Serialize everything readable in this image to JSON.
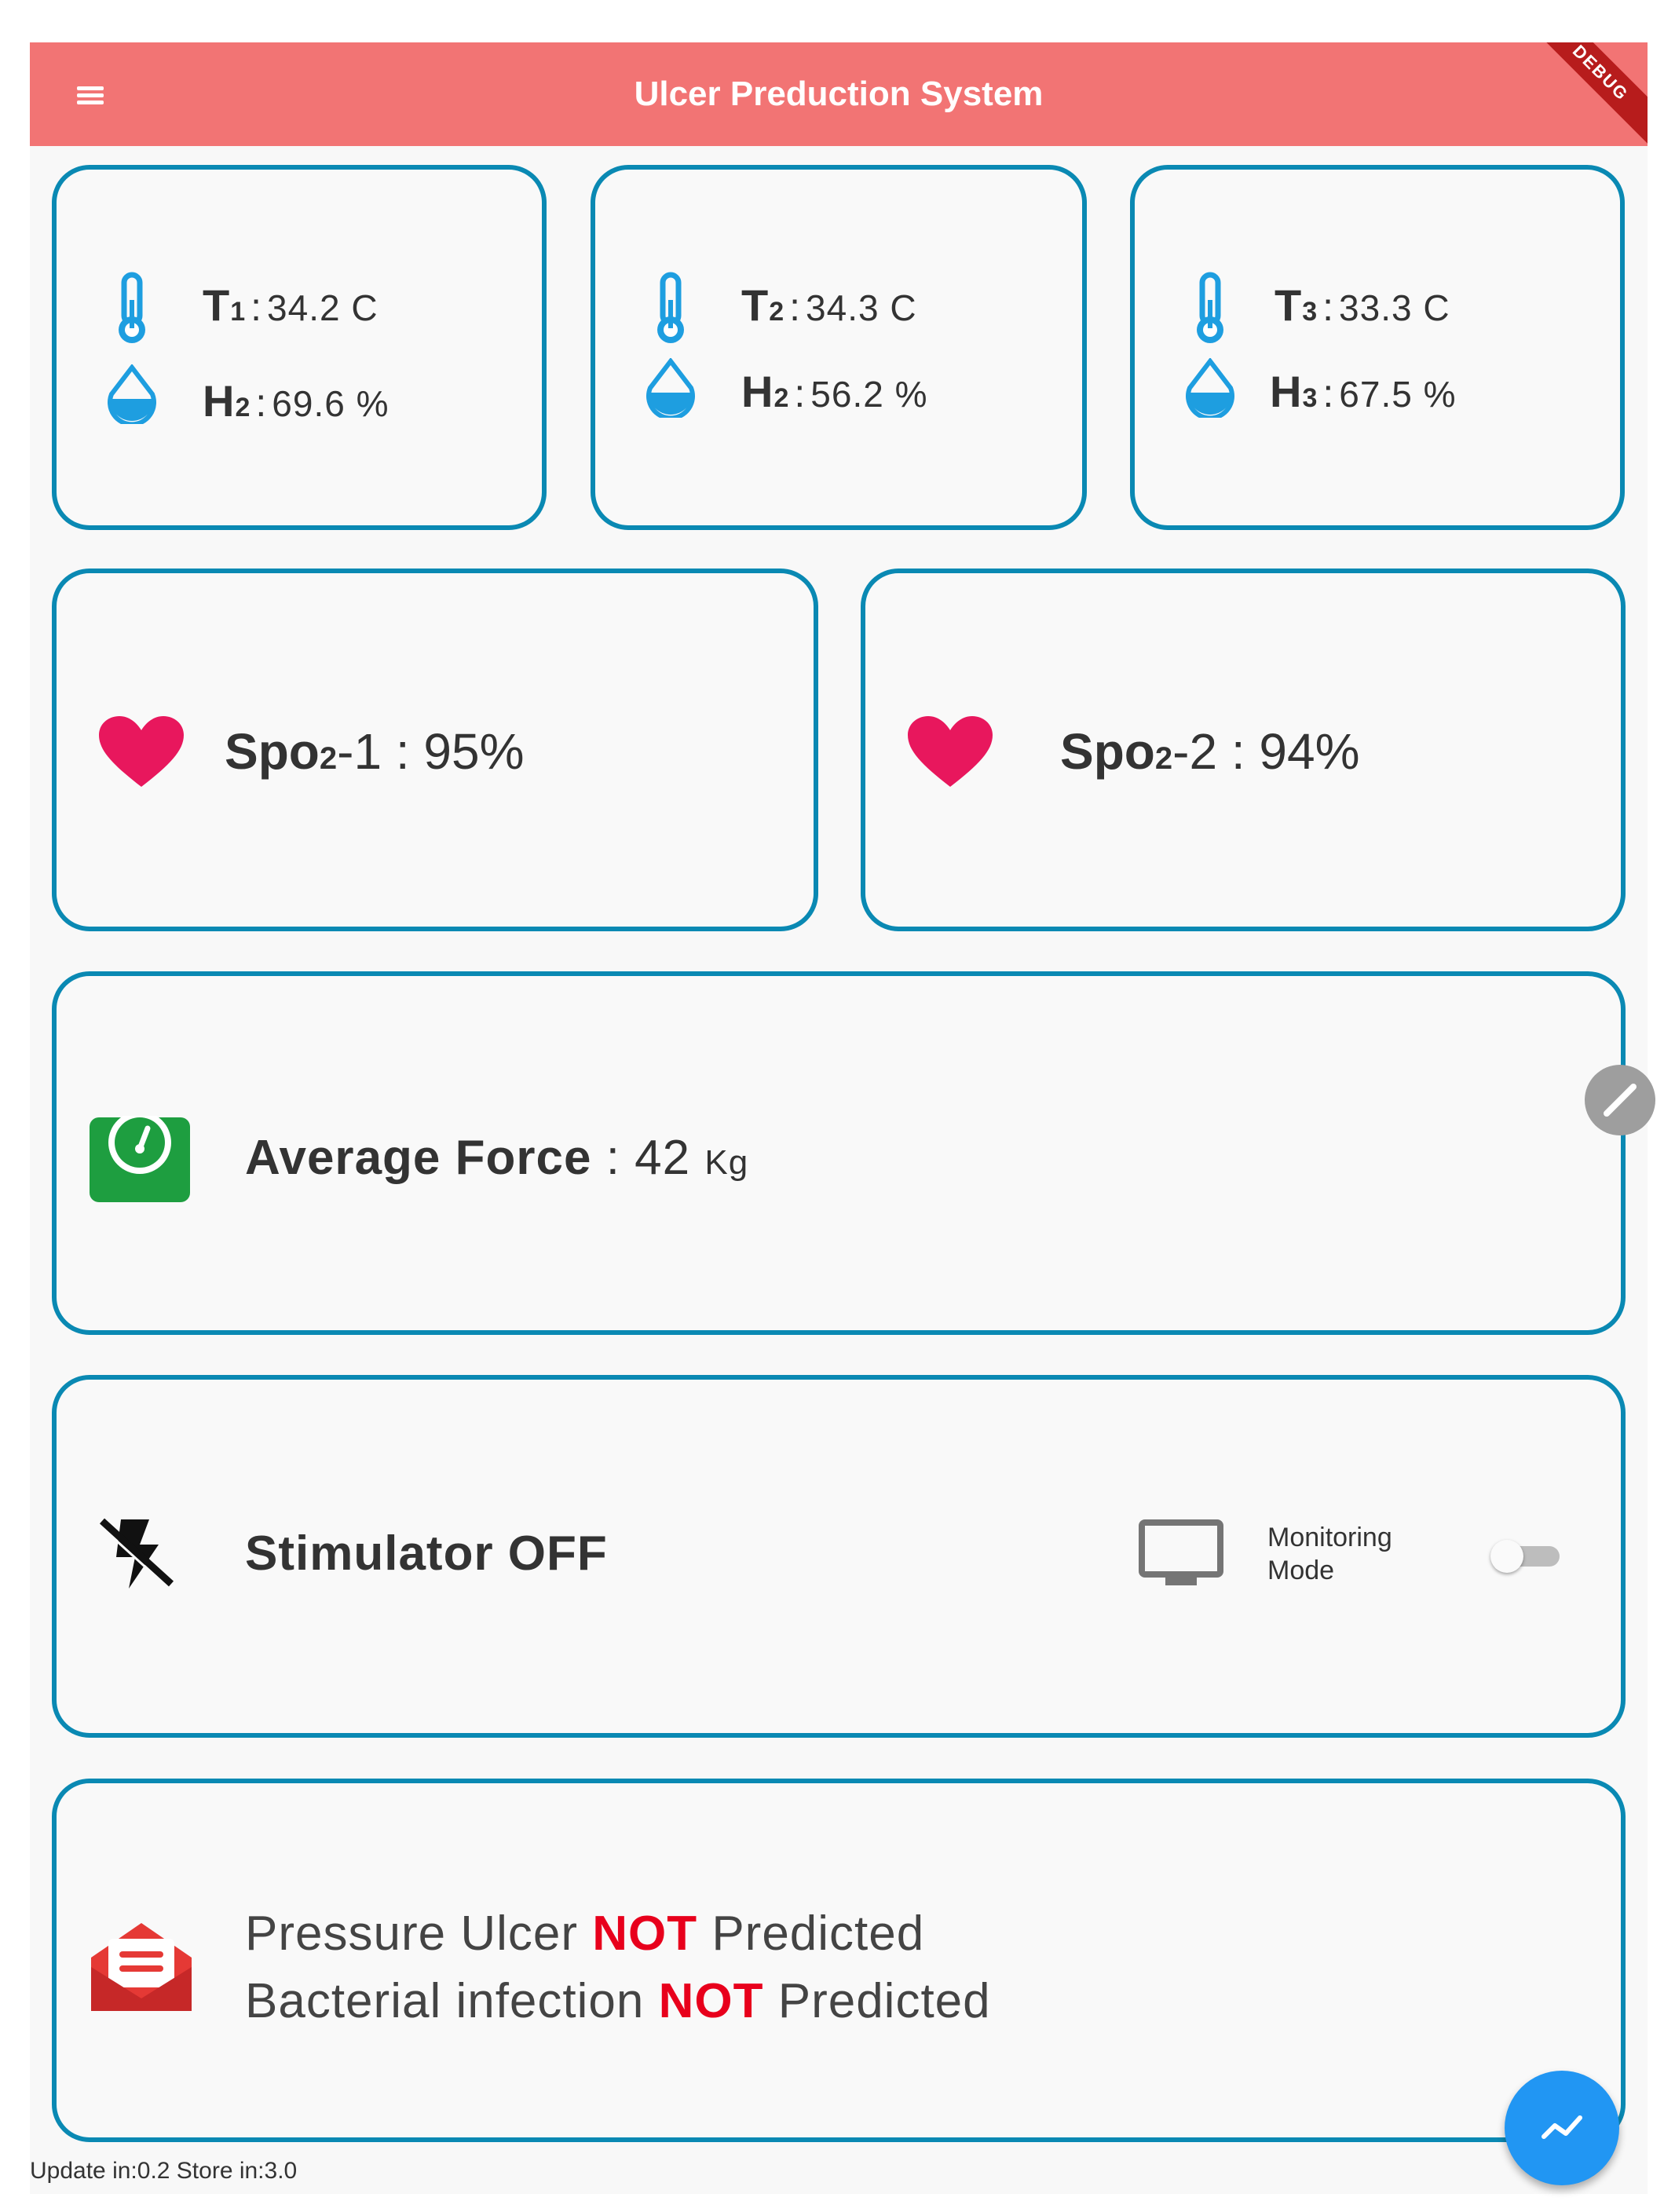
{
  "appbar": {
    "title": "Ulcer Preduction System",
    "menu_icon": "hamburger-menu-icon",
    "color": "#f27474",
    "debug_ribbon": "DEBUG"
  },
  "sensors": [
    {
      "t_label": "T",
      "t_sub": "1",
      "t_value": "34.2 C",
      "h_label": "H",
      "h_sub": "2",
      "h_value": "69.6 %"
    },
    {
      "t_label": "T",
      "t_sub": "2",
      "t_value": "34.3 C",
      "h_label": "H",
      "h_sub": "2",
      "h_value": "56.2 %"
    },
    {
      "t_label": "T",
      "t_sub": "3",
      "t_value": "33.3 C",
      "h_label": "H",
      "h_sub": "3",
      "h_value": "67.5 %"
    }
  ],
  "spo2": [
    {
      "label": "Spo",
      "sub": "2",
      "suffix": "-1",
      "value": "95%"
    },
    {
      "label": "Spo",
      "sub": "2",
      "suffix": "-2",
      "value": "94%"
    }
  ],
  "force": {
    "label": "Average Force",
    "value": "42",
    "unit": "Kg"
  },
  "stimulator": {
    "status": "Stimulator OFF",
    "monitoring_line1": "Monitoring",
    "monitoring_line2": "Mode",
    "monitoring_on": false
  },
  "prediction": {
    "line1_pre": "Pressure Ulcer ",
    "line1_hl": "NOT",
    "line1_post": " Predicted",
    "line2_pre": "Bacterial infection ",
    "line2_hl": "NOT",
    "line2_post": " Predicted"
  },
  "footer": {
    "text": "Update in:0.2 Store in:3.0"
  },
  "colors": {
    "card_border": "#0a89b3",
    "accent_red": "#e8001c",
    "fab": "#2196f3",
    "heart": "#e8175d",
    "gauge": "#1e9e40",
    "mail": "#e53935",
    "droplet": "#1e9ee0"
  },
  "icons": {
    "temperature": "thermometer-icon",
    "humidity": "droplet-icon",
    "spo2": "heart-icon",
    "force": "weight-scale-icon",
    "stimulator": "flash-off-icon",
    "monitor": "monitor-icon",
    "prediction": "mail-open-icon",
    "fab": "chart-line-icon",
    "handle": "edit-pencil-icon"
  }
}
